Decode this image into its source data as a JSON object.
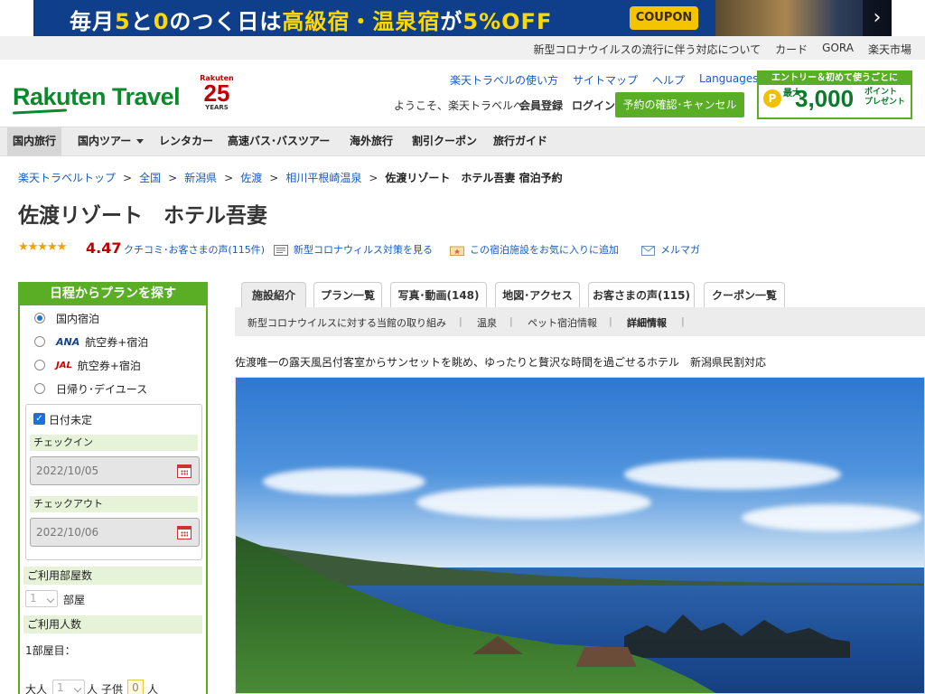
{
  "promo": {
    "text_a": "毎月",
    "text_b": "5",
    "text_c": "と",
    "text_d": "0",
    "text_e": "のつく日は",
    "text_f": "高級宿・温泉宿",
    "text_g": "が",
    "text_h": "5%OFF",
    "coupon": "COUPON",
    "next": "›"
  },
  "utility": {
    "links": [
      "新型コロナウイルスの流行に伴う対応について",
      "カード",
      "GORA",
      "楽天市場"
    ]
  },
  "header": {
    "logo": "Rakuten Travel",
    "anniv_brand": "Rakuten",
    "anniv_number": "25",
    "anniv_years": "YEARS",
    "links": [
      "楽天トラベルの使い方",
      "サイトマップ",
      "ヘルプ",
      "Languages"
    ],
    "welcome": "ようこそ、楽天トラベルへ",
    "register": "会員登録",
    "login": "ログイン",
    "confirm_cancel": "予約の確認･キャンセル",
    "entry": {
      "top": "エントリー＆初めて使うごとに",
      "coin": "P",
      "max": "最大",
      "amount": "3,000",
      "point": "ポイント",
      "present": "プレゼント"
    }
  },
  "gnav": {
    "items": [
      "国内旅行",
      "国内ツアー",
      "レンタカー",
      "高速バス･バスツアー",
      "海外旅行",
      "割引クーポン",
      "旅行ガイド"
    ]
  },
  "breadcrumb": {
    "items": [
      "楽天トラベルトップ",
      "全国",
      "新潟県",
      "佐渡",
      "相川平根崎温泉"
    ],
    "current": "佐渡リゾート　ホテル吾妻 宿泊予約",
    "sep": ">"
  },
  "hotel": {
    "name": "佐渡リゾート　ホテル吾妻",
    "stars": "★★★★★",
    "score": "4.47",
    "review_link": "クチコミ･お客さまの声(115件)",
    "covid_link": "新型コロナウィルス対策を見る",
    "fav_link": "この宿泊施設をお気に入りに追加",
    "mail_link": "メルマガ",
    "catch": "佐渡唯一の露天風呂付客室からサンセットを眺め、ゆったりと贅沢な時間を過ごせるホテル　新潟県民割対応"
  },
  "search": {
    "title": "日程からプランを探す",
    "opt_domestic": "国内宿泊",
    "opt_ana_logo": "ANA",
    "opt_ana": "航空券+宿泊",
    "opt_jal_logo": "JAL",
    "opt_jal": "航空券+宿泊",
    "opt_day": "日帰り･デイユース",
    "undecided": "日付未定",
    "checkin_label": "チェックイン",
    "checkin_value": "2022/10/05",
    "checkout_label": "チェックアウト",
    "checkout_value": "2022/10/06",
    "rooms_label": "ご利用部屋数",
    "rooms_value": "1",
    "rooms_unit": "部屋",
    "people_label": "ご利用人数",
    "room1": "1部屋目：",
    "adult_label": "大人",
    "adult_value": "1",
    "person_unit": "人",
    "child_label": "子供",
    "child_value": "0",
    "child_unit": "人"
  },
  "tabs": [
    {
      "label": "施設紹介"
    },
    {
      "label": "プラン一覧"
    },
    {
      "label": "写真･動画(148)"
    },
    {
      "label": "地図･アクセス"
    },
    {
      "label": "お客さまの声(115)"
    },
    {
      "label": "クーポン一覧"
    }
  ],
  "subnav": {
    "items": [
      "新型コロナウイルスに対する当館の取り組み",
      "温泉",
      "ペット宿泊情報",
      "詳細情報"
    ],
    "sep": "|"
  }
}
